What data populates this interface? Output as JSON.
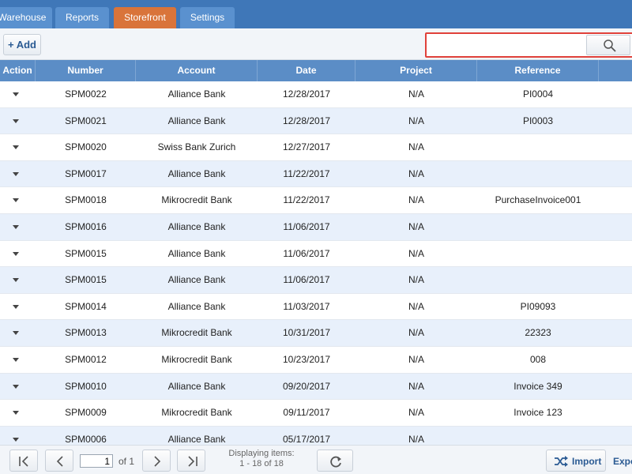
{
  "tabs": [
    {
      "label": "Warehouse",
      "active": false
    },
    {
      "label": "Reports",
      "active": false
    },
    {
      "label": "Storefront",
      "active": true
    },
    {
      "label": "Settings",
      "active": false
    }
  ],
  "toolbar": {
    "add_label": "+ Add",
    "search_value": "",
    "search_icon": "search-icon"
  },
  "columns": [
    "Action",
    "Number",
    "Account",
    "Date",
    "Project",
    "Reference"
  ],
  "rows": [
    {
      "number": "SPM0022",
      "account": "Alliance Bank",
      "date": "12/28/2017",
      "project": "N/A",
      "reference": "PI0004"
    },
    {
      "number": "SPM0021",
      "account": "Alliance Bank",
      "date": "12/28/2017",
      "project": "N/A",
      "reference": "PI0003"
    },
    {
      "number": "SPM0020",
      "account": "Swiss Bank Zurich",
      "date": "12/27/2017",
      "project": "N/A",
      "reference": ""
    },
    {
      "number": "SPM0017",
      "account": "Alliance Bank",
      "date": "11/22/2017",
      "project": "N/A",
      "reference": ""
    },
    {
      "number": "SPM0018",
      "account": "Mikrocredit Bank",
      "date": "11/22/2017",
      "project": "N/A",
      "reference": "PurchaseInvoice001"
    },
    {
      "number": "SPM0016",
      "account": "Alliance Bank",
      "date": "11/06/2017",
      "project": "N/A",
      "reference": ""
    },
    {
      "number": "SPM0015",
      "account": "Alliance Bank",
      "date": "11/06/2017",
      "project": "N/A",
      "reference": ""
    },
    {
      "number": "SPM0015",
      "account": "Alliance Bank",
      "date": "11/06/2017",
      "project": "N/A",
      "reference": ""
    },
    {
      "number": "SPM0014",
      "account": "Alliance Bank",
      "date": "11/03/2017",
      "project": "N/A",
      "reference": "PI09093"
    },
    {
      "number": "SPM0013",
      "account": "Mikrocredit Bank",
      "date": "10/31/2017",
      "project": "N/A",
      "reference": "22323"
    },
    {
      "number": "SPM0012",
      "account": "Mikrocredit Bank",
      "date": "10/23/2017",
      "project": "N/A",
      "reference": "008"
    },
    {
      "number": "SPM0010",
      "account": "Alliance Bank",
      "date": "09/20/2017",
      "project": "N/A",
      "reference": "Invoice 349"
    },
    {
      "number": "SPM0009",
      "account": "Mikrocredit Bank",
      "date": "09/11/2017",
      "project": "N/A",
      "reference": "Invoice 123"
    },
    {
      "number": "SPM0006",
      "account": "Alliance Bank",
      "date": "05/17/2017",
      "project": "N/A",
      "reference": ""
    }
  ],
  "pager": {
    "page_value": "1",
    "of_text": "of 1",
    "display_line1": "Displaying items:",
    "display_line2": "1 - 18 of 18",
    "import_label": "Import",
    "export_label": "Expo"
  },
  "colors": {
    "tabbar": "#3f77b8",
    "active_tab": "#d9743a",
    "header": "#5b8dc6",
    "alt_row": "#e8f0fb",
    "search_highlight": "#e0413a"
  }
}
